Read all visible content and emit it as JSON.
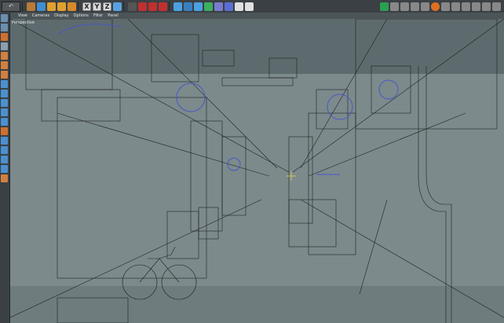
{
  "app": {
    "mode_field": "↶",
    "axis_labels": [
      "X",
      "Y",
      "Z"
    ],
    "accent": "#f0a23a"
  },
  "viewport": {
    "menu": [
      "View",
      "Cameras",
      "Display",
      "Options",
      "Filter",
      "Panel"
    ],
    "camera_label": "Perspective"
  },
  "toolbar_icons": {
    "left": [
      "undo-icon",
      "select-icon",
      "move-icon",
      "scale-icon",
      "rotate-icon",
      "add-icon"
    ],
    "right": [
      "render-view-icon",
      "render-region-icon",
      "render-settings-icon",
      "cube-icon",
      "pen-icon",
      "subdivide-icon",
      "deformer-icon",
      "environment-icon",
      "camera-icon",
      "light-icon"
    ],
    "far_right": [
      "spline-icon",
      "snap-icon",
      "magnet-icon",
      "brush-icon",
      "dollar-icon",
      "layers-icon",
      "grid-icon",
      "display-icon",
      "options-icon",
      "filter-icon",
      "panel-icon",
      "lock-icon"
    ]
  }
}
